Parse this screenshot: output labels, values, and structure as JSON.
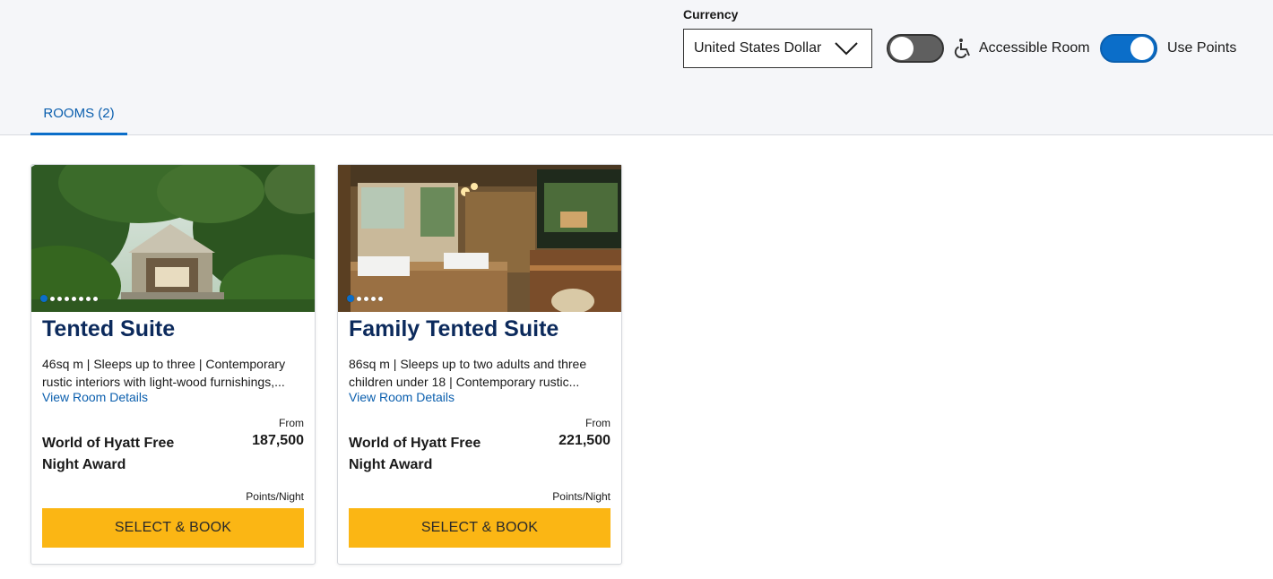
{
  "filters": {
    "currency_label": "Currency",
    "currency_value": "United States Dollar",
    "accessible": {
      "label": "Accessible Room",
      "on": false
    },
    "points": {
      "label": "Use Points",
      "on": true
    }
  },
  "tabs": [
    {
      "label": "ROOMS (2)",
      "active": true
    }
  ],
  "rooms": [
    {
      "title": "Tented Suite",
      "description": "46sq m | Sleeps up to three | Contemporary rustic interiors with light-wood furnishings,...",
      "details_link": "View Room Details",
      "from_label": "From",
      "rate_name": "World of Hyatt Free Night Award",
      "points": "187,500",
      "points_unit": "Points/Night",
      "button": "SELECT & BOOK",
      "photo_count": 8,
      "photo_index": 1
    },
    {
      "title": "Family Tented Suite",
      "description": "86sq m | Sleeps up to two adults and three children under 18 | Contemporary rustic...",
      "details_link": "View Room Details",
      "from_label": "From",
      "rate_name": "World of Hyatt Free Night Award",
      "points": "221,500",
      "points_unit": "Points/Night",
      "button": "SELECT & BOOK",
      "photo_count": 5,
      "photo_index": 1
    }
  ],
  "colors": {
    "brand_blue": "#0b6ec9",
    "title_navy": "#0c2a5c",
    "book_yellow": "#fbb614",
    "toggle_off": "#5f5f5f"
  }
}
